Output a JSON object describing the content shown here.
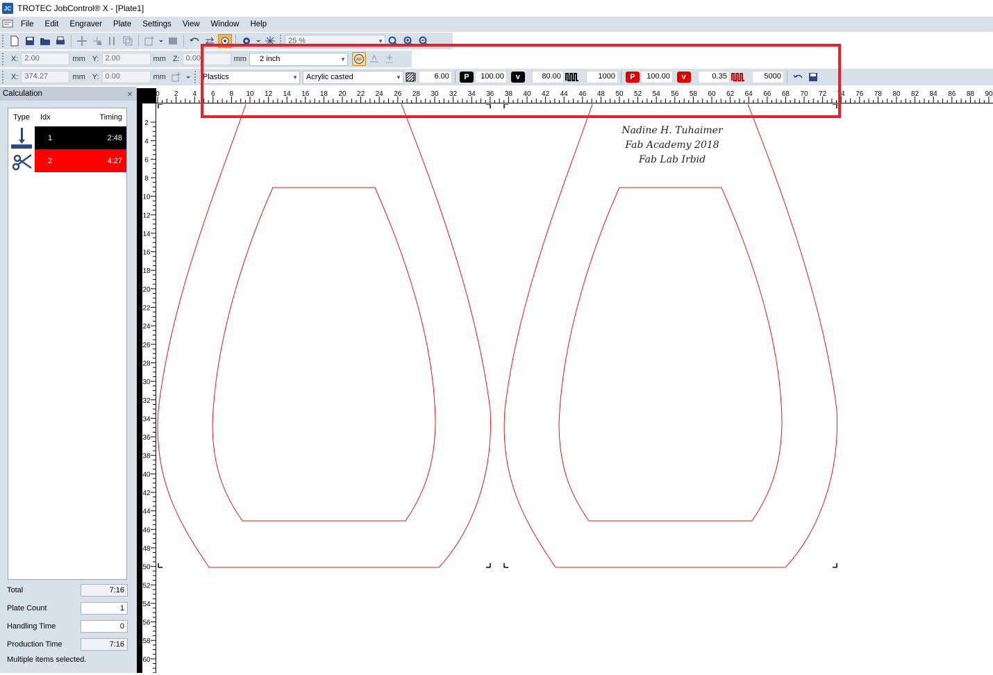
{
  "window": {
    "title": "TROTEC JobControl® X - [Plate1]",
    "app_icon": "JC"
  },
  "menu": [
    "File",
    "Edit",
    "Engraver",
    "Plate",
    "Settings",
    "View",
    "Window",
    "Help"
  ],
  "toolbar": {
    "zoom": "25 %"
  },
  "position": {
    "x_label": "X:",
    "x_value": "2.00",
    "x_unit": "mm",
    "y_label": "Y:",
    "y_value": "2.00",
    "y_unit": "mm",
    "z_label": "Z:",
    "z_value": "0.00",
    "z_unit": "mm",
    "lens": "2 inch",
    "af_label": "AF"
  },
  "size": {
    "x_label": "X:",
    "x_value": "374.27",
    "x_unit": "mm",
    "y_label": "Y:",
    "y_value": "0.00",
    "y_unit": "mm"
  },
  "material": {
    "group": "Plastics",
    "type": "Acrylic casted",
    "thickness": "6.00",
    "engrave_power": "100.00",
    "engrave_velocity": "80.00",
    "engrave_ppi": "1000",
    "cut_power": "100.00",
    "cut_velocity": "0.35",
    "cut_frequency": "5000",
    "chip_p": "P",
    "chip_v": "v"
  },
  "calculation": {
    "title": "Calculation",
    "close": "×",
    "headers": {
      "type": "Type",
      "idx": "Idx",
      "timing": "Timing"
    },
    "rows": [
      {
        "idx": "1",
        "timing": "2:48",
        "color": "#000000",
        "type_icon": "engrave-icon"
      },
      {
        "idx": "2",
        "timing": "4:27",
        "color": "#ff0000",
        "type_icon": "scissors-icon"
      }
    ],
    "total_label": "Total",
    "total": "7:16",
    "plate_count_label": "Plate Count",
    "plate_count": "1",
    "handling_label": "Handling Time",
    "handling": "0",
    "production_label": "Production Time",
    "production": "7:16"
  },
  "status": "Multiple items selected.",
  "ruler": {
    "h_labels": [
      "0",
      "2",
      "4",
      "6",
      "8",
      "10",
      "12",
      "14",
      "16",
      "18",
      "20",
      "22",
      "24",
      "26",
      "28",
      "30",
      "32",
      "34",
      "36",
      "38",
      "40",
      "42",
      "44",
      "46",
      "48",
      "50",
      "52",
      "54",
      "56",
      "58",
      "60",
      "62",
      "64",
      "66",
      "68",
      "70",
      "72",
      "74",
      "76",
      "78",
      "80",
      "82",
      "84",
      "86",
      "88",
      "90"
    ],
    "v_labels": [
      "2",
      "4",
      "6",
      "8",
      "10",
      "12",
      "14",
      "16",
      "18",
      "20",
      "22",
      "24",
      "26",
      "28",
      "30",
      "32",
      "34",
      "36",
      "38",
      "40",
      "42",
      "44",
      "46",
      "48",
      "50",
      "52",
      "54",
      "56",
      "58",
      "60"
    ]
  },
  "engraving": {
    "line1": "Nadine H. Tuhaimer",
    "line2": "Fab Academy 2018",
    "line3": "Fab Lab Irbid"
  },
  "colors": {
    "cut_line": "#e01818",
    "highlight": "#e8202a",
    "chrome": "#d8e0ea"
  }
}
